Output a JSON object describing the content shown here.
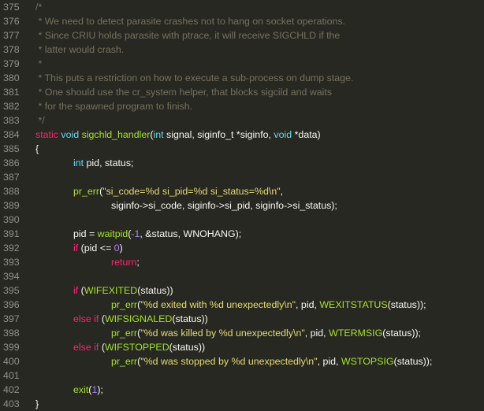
{
  "editor": {
    "theme_colors": {
      "background": "#272822",
      "foreground": "#f8f8f2",
      "comment": "#75715e",
      "keyword": "#f92672",
      "type": "#66d9ef",
      "function": "#a6e22e",
      "string": "#e6db74",
      "number": "#ae81ff",
      "line_number": "#8f908a"
    },
    "lines": [
      {
        "num": "375",
        "indent": 0,
        "tokens": [
          [
            "c",
            "/*"
          ]
        ]
      },
      {
        "num": "376",
        "indent": 0,
        "tokens": [
          [
            "c",
            " * We need to detect parasite crashes not to hang on socket operations."
          ]
        ]
      },
      {
        "num": "377",
        "indent": 0,
        "tokens": [
          [
            "c",
            " * Since CRIU holds parasite with ptrace, it will receive SIGCHLD if the"
          ]
        ]
      },
      {
        "num": "378",
        "indent": 0,
        "tokens": [
          [
            "c",
            " * latter would crash."
          ]
        ]
      },
      {
        "num": "379",
        "indent": 0,
        "tokens": [
          [
            "c",
            " *"
          ]
        ]
      },
      {
        "num": "380",
        "indent": 0,
        "tokens": [
          [
            "c",
            " * This puts a restriction on how to execute a sub-process on dump stage."
          ]
        ]
      },
      {
        "num": "381",
        "indent": 0,
        "tokens": [
          [
            "c",
            " * One should use the cr_system helper, that blocks sigcild and waits"
          ]
        ]
      },
      {
        "num": "382",
        "indent": 0,
        "tokens": [
          [
            "c",
            " * for the spawned program to finish."
          ]
        ]
      },
      {
        "num": "383",
        "indent": 0,
        "tokens": [
          [
            "c",
            " */"
          ]
        ]
      },
      {
        "num": "384",
        "indent": 0,
        "tokens": [
          [
            "k",
            "static "
          ],
          [
            "t",
            "void "
          ],
          [
            "f",
            "sigchld_handler"
          ],
          [
            "p",
            "("
          ],
          [
            "t",
            "int "
          ],
          [
            "p",
            "signal, siginfo_t *siginfo, "
          ],
          [
            "t",
            "void "
          ],
          [
            "p",
            "*data)"
          ]
        ]
      },
      {
        "num": "385",
        "indent": 0,
        "tokens": [
          [
            "p",
            "{"
          ]
        ]
      },
      {
        "num": "386",
        "indent": 1,
        "tokens": [
          [
            "t",
            "int "
          ],
          [
            "p",
            "pid, status;"
          ]
        ]
      },
      {
        "num": "387",
        "indent": 0,
        "tokens": []
      },
      {
        "num": "388",
        "indent": 1,
        "tokens": [
          [
            "f",
            "pr_err"
          ],
          [
            "p",
            "("
          ],
          [
            "s",
            "\"si_code=%d si_pid=%d si_status=%d\\n\""
          ],
          [
            "p",
            ","
          ]
        ]
      },
      {
        "num": "389",
        "indent": 2,
        "tokens": [
          [
            "p",
            "siginfo->si_code, siginfo->si_pid, siginfo->si_status);"
          ]
        ]
      },
      {
        "num": "390",
        "indent": 0,
        "tokens": []
      },
      {
        "num": "391",
        "indent": 1,
        "tokens": [
          [
            "p",
            "pid = "
          ],
          [
            "f",
            "waitpid"
          ],
          [
            "p",
            "("
          ],
          [
            "n",
            "-1"
          ],
          [
            "p",
            ", &status, WNOHANG);"
          ]
        ]
      },
      {
        "num": "392",
        "indent": 1,
        "tokens": [
          [
            "k",
            "if "
          ],
          [
            "p",
            "(pid <= "
          ],
          [
            "n",
            "0"
          ],
          [
            "p",
            ")"
          ]
        ]
      },
      {
        "num": "393",
        "indent": 2,
        "tokens": [
          [
            "k",
            "return"
          ],
          [
            "p",
            ";"
          ]
        ]
      },
      {
        "num": "394",
        "indent": 0,
        "tokens": []
      },
      {
        "num": "395",
        "indent": 1,
        "tokens": [
          [
            "k",
            "if "
          ],
          [
            "p",
            "("
          ],
          [
            "f",
            "WIFEXITED"
          ],
          [
            "p",
            "(status))"
          ]
        ]
      },
      {
        "num": "396",
        "indent": 2,
        "tokens": [
          [
            "f",
            "pr_err"
          ],
          [
            "p",
            "("
          ],
          [
            "s",
            "\"%d exited with %d unexpectedly\\n\""
          ],
          [
            "p",
            ", pid, "
          ],
          [
            "f",
            "WEXITSTATUS"
          ],
          [
            "p",
            "(status));"
          ]
        ]
      },
      {
        "num": "397",
        "indent": 1,
        "tokens": [
          [
            "k",
            "else if "
          ],
          [
            "p",
            "("
          ],
          [
            "f",
            "WIFSIGNALED"
          ],
          [
            "p",
            "(status))"
          ]
        ]
      },
      {
        "num": "398",
        "indent": 2,
        "tokens": [
          [
            "f",
            "pr_err"
          ],
          [
            "p",
            "("
          ],
          [
            "s",
            "\"%d was killed by %d unexpectedly\\n\""
          ],
          [
            "p",
            ", pid, "
          ],
          [
            "f",
            "WTERMSIG"
          ],
          [
            "p",
            "(status));"
          ]
        ]
      },
      {
        "num": "399",
        "indent": 1,
        "tokens": [
          [
            "k",
            "else if "
          ],
          [
            "p",
            "("
          ],
          [
            "f",
            "WIFSTOPPED"
          ],
          [
            "p",
            "(status))"
          ]
        ]
      },
      {
        "num": "400",
        "indent": 2,
        "tokens": [
          [
            "f",
            "pr_err"
          ],
          [
            "p",
            "("
          ],
          [
            "s",
            "\"%d was stopped by %d unexpectedly\\n\""
          ],
          [
            "p",
            ", pid, "
          ],
          [
            "f",
            "WSTOPSIG"
          ],
          [
            "p",
            "(status));"
          ]
        ]
      },
      {
        "num": "401",
        "indent": 0,
        "tokens": []
      },
      {
        "num": "402",
        "indent": 1,
        "tokens": [
          [
            "f",
            "exit"
          ],
          [
            "p",
            "("
          ],
          [
            "n",
            "1"
          ],
          [
            "p",
            ");"
          ]
        ]
      },
      {
        "num": "403",
        "indent": 0,
        "tokens": [
          [
            "p",
            "}"
          ]
        ]
      }
    ]
  }
}
